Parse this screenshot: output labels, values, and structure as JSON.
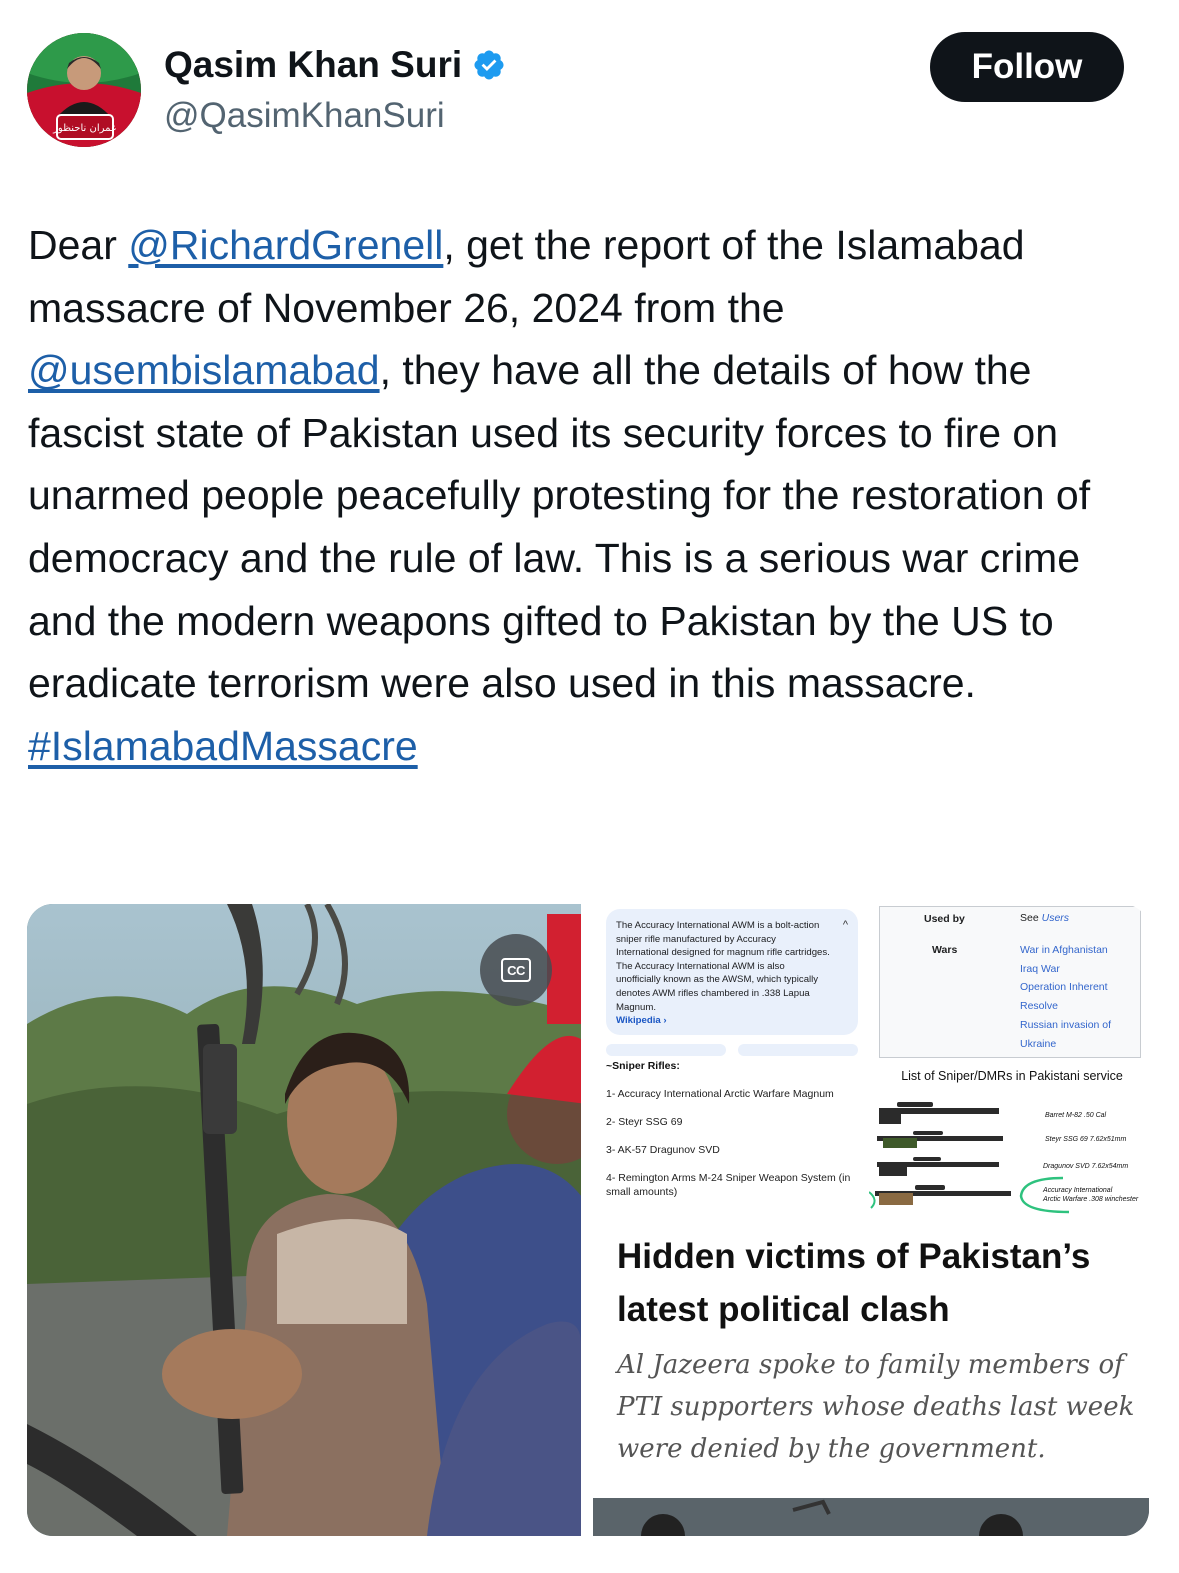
{
  "author": {
    "name": "Qasim Khan Suri",
    "handle": "@QasimKhanSuri",
    "avatar_badge_text": "عمران ناحنظور"
  },
  "follow_label": "Follow",
  "tweet": {
    "t1": "Dear ",
    "mention1": "@RichardGrenell",
    "t2": ", get the report of the Islamabad massacre of November 26, 2024 from the ",
    "mention2": "@usembislamabad",
    "t3": ", they have all the details of how the fascist state of Pakistan used its security forces to fire on unarmed people peacefully protesting for the restoration of democracy and the rule of law. This is a serious war crime and the modern weapons gifted to Pakistan by the US to eradicate terrorism were also used in this massacre.",
    "hashtag": "#IslamabadMassacre"
  },
  "media": {
    "cc_label": "CC",
    "wiki_snippet": "The Accuracy International AWM is a bolt-action sniper rifle manufactured by Accuracy International designed for magnum rifle cartridges. The Accuracy International AWM is also unofficially known as the AWSM, which typically denotes AWM rifles chambered in .338 Lapua Magnum.",
    "wiki_source": "Wikipedia ›",
    "sniper_title": "~Sniper Rifles:",
    "sniper_items": [
      "1- Accuracy International Arctic Warfare Magnum",
      "2- Steyr SSG 69",
      "3- AK-57 Dragunov SVD",
      "4- Remington Arms M-24 Sniper Weapon System (in small amounts)"
    ],
    "infobox": {
      "used_by_label": "Used by",
      "used_by_prefix": "See ",
      "used_by_value": "Users",
      "wars_label": "Wars",
      "wars": [
        "War in Afghanistan",
        "Iraq War",
        "Operation Inherent",
        "Resolve",
        "Russian invasion of",
        "Ukraine"
      ]
    },
    "list_title": "List of Sniper/DMRs in Pakistani service",
    "guns": [
      "Barret M-82  .50 Cal",
      "Steyr SSG 69  7.62x51mm",
      "Dragunov SVD  7.62x54mm",
      "Accuracy International",
      "Arctic Warfare .308 winchester"
    ],
    "headline": "Hidden victims of Pakistan’s latest political clash",
    "subhead": "Al Jazeera spoke to family members of PTI supporters whose deaths last week were denied by the government."
  },
  "colors": {
    "link": "#1d5fa8",
    "follow_bg": "#0f1419",
    "verified": "#1d9bf0",
    "muted": "#536471"
  }
}
